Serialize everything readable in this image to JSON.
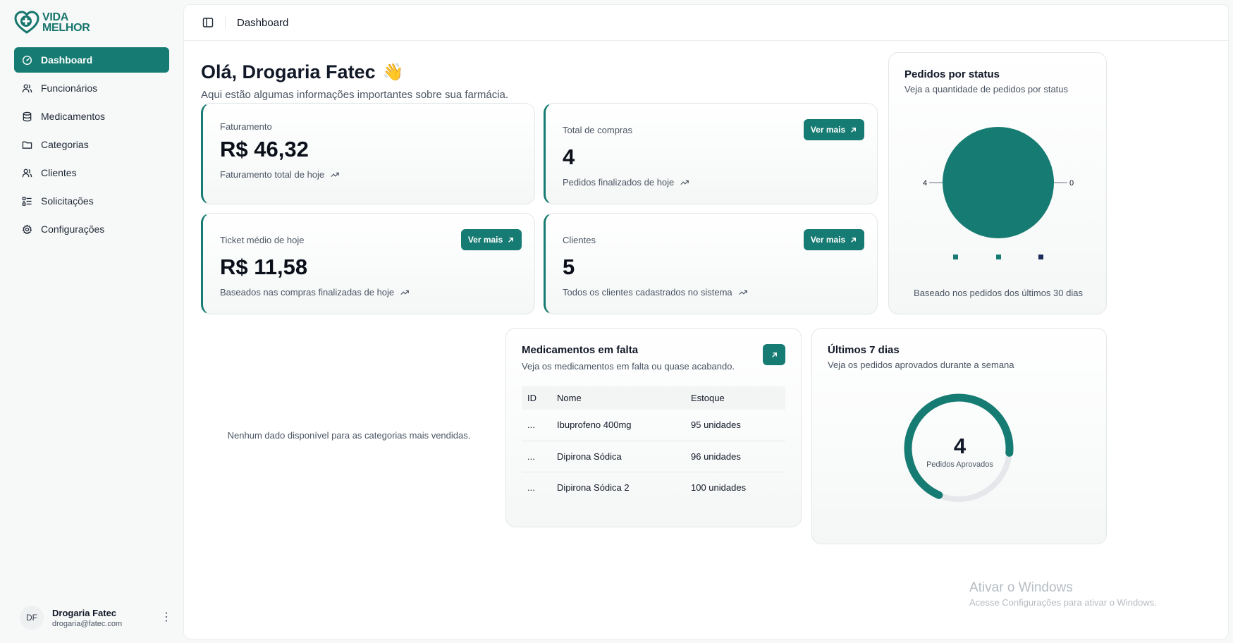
{
  "brand": {
    "name_line1": "VIDA",
    "name_line2": "MELHOR"
  },
  "sidebar": {
    "items": [
      {
        "label": "Dashboard",
        "icon": "gauge-icon"
      },
      {
        "label": "Funcionários",
        "icon": "users-icon"
      },
      {
        "label": "Medicamentos",
        "icon": "database-icon"
      },
      {
        "label": "Categorias",
        "icon": "folder-icon"
      },
      {
        "label": "Clientes",
        "icon": "users-icon"
      },
      {
        "label": "Solicitações",
        "icon": "list-checks-icon"
      },
      {
        "label": "Configurações",
        "icon": "gear-icon"
      }
    ],
    "active_index": 0
  },
  "user": {
    "initials": "DF",
    "name": "Drogaria Fatec",
    "email": "drogaria@fatec.com",
    "menu": "⋮"
  },
  "topbar": {
    "title": "Dashboard"
  },
  "greeting": {
    "title": "Olá, Drogaria Fatec",
    "emoji": "👋",
    "subtitle": "Aqui estão algumas informações importantes sobre sua farmácia."
  },
  "stats": {
    "revenue": {
      "label": "Faturamento",
      "value": "R$ 46,32",
      "note": "Faturamento total de hoje"
    },
    "purchases": {
      "label": "Total de compras",
      "value": "4",
      "note": "Pedidos finalizados de hoje",
      "button": "Ver mais"
    },
    "ticket": {
      "label": "Ticket médio de hoje",
      "value": "R$ 11,58",
      "note": "Baseados nas compras finalizadas de hoje",
      "button": "Ver mais"
    },
    "clients": {
      "label": "Clientes",
      "value": "5",
      "note": "Todos os clientes cadastrados no sistema",
      "button": "Ver mais"
    }
  },
  "status_panel": {
    "title": "Pedidos por status",
    "subtitle": "Veja a quantidade de pedidos por status",
    "footer": "Baseado nos pedidos dos últimos 30 dias",
    "label_left": "4",
    "label_right": "0",
    "legend_colors": [
      "#167b72",
      "#167b72",
      "#1e2a5a"
    ]
  },
  "chart_data": {
    "type": "pie",
    "values": [
      4,
      0,
      0
    ],
    "colors": [
      "#167b72",
      "#167b72",
      "#1e2a5a"
    ]
  },
  "categories_panel": {
    "empty": "Nenhum dado disponível para as categorias mais vendidas."
  },
  "missing_panel": {
    "title": "Medicamentos em falta",
    "subtitle": "Veja os medicamentos em falta ou quase acabando.",
    "columns": [
      "ID",
      "Nome",
      "Estoque"
    ],
    "rows": [
      {
        "id": "...",
        "name": "Ibuprofeno 400mg",
        "stock": "95 unidades"
      },
      {
        "id": "...",
        "name": "Dipirona Sódica",
        "stock": "96 unidades"
      },
      {
        "id": "...",
        "name": "Dipirona Sódica 2",
        "stock": "100 unidades"
      }
    ]
  },
  "week_panel": {
    "title": "Últimos 7 dias",
    "subtitle": "Veja os pedidos aprovados durante a semana",
    "value": "4",
    "value_label": "Pedidos Aprovados",
    "progress": 0.7
  },
  "watermark": {
    "line1": "Ativar o Windows",
    "line2": "Acesse Configurações para ativar o Windows."
  },
  "colors": {
    "accent": "#167b72",
    "warning": "#d97706"
  }
}
